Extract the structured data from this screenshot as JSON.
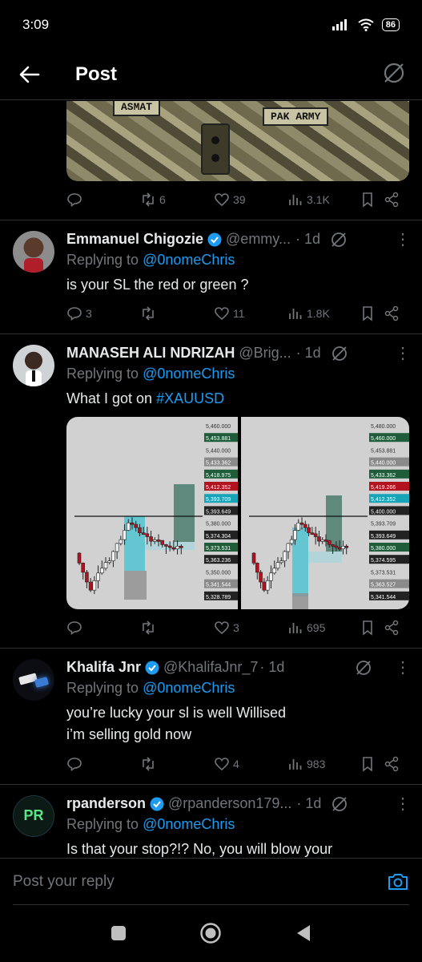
{
  "status": {
    "time": "3:09",
    "battery": "86"
  },
  "header": {
    "title": "Post"
  },
  "top_post": {
    "patch_left": "ASMAT",
    "patch_right": "PAK ARMY",
    "reposts": "6",
    "likes": "39",
    "views": "3.1K"
  },
  "tweets": [
    {
      "name": "Emmanuel Chigozie",
      "handle": "@emmy...",
      "time": "· 1d",
      "replying_prefix": "Replying to ",
      "replying_to": "@0nomeChris",
      "text": "is your SL the red or green ?",
      "replies": "3",
      "reposts": "",
      "likes": "11",
      "views": "1.8K"
    },
    {
      "name": "MANASEH ALI NDRIZAH",
      "handle": "@Brig...",
      "time": "· 1d",
      "replying_prefix": "Replying to ",
      "replying_to": "@0nomeChris",
      "text_prefix": "What I got on ",
      "hashtag": "#XAUUSD",
      "replies": "",
      "reposts": "",
      "likes": "3",
      "views": "695",
      "chart_left_prices": [
        "5,460.000",
        "5,453.881",
        "5,440.000",
        "5,433.362",
        "5,418.975",
        "5,412.352",
        "5,393.709",
        "5,393.649",
        "5,380.000",
        "5,374.304",
        "5,373.531",
        "5,363.236",
        "5,350.000",
        "5,341.544",
        "5,328.789"
      ],
      "chart_right_prices": [
        "5,480.000",
        "5,460.000",
        "5,453.881",
        "5,440.000",
        "5,433.362",
        "5,419.266",
        "5,412.352",
        "5,400.000",
        "5,393.709",
        "5,393.649",
        "5,380.000",
        "5,374.595",
        "5,373.531",
        "5,363.527",
        "5,341.544"
      ]
    },
    {
      "name": "Khalifa Jnr",
      "handle": "@KhalifaJnr_7",
      "time": "· 1d",
      "replying_prefix": "Replying to ",
      "replying_to": "@0nomeChris",
      "text_line1": "you’re lucky your sl is well Willised",
      "text_line2": "i’m selling gold now",
      "replies": "",
      "reposts": "",
      "likes": "4",
      "views": "983"
    },
    {
      "name": "rpanderson",
      "handle": "@rpanderson179...",
      "time": "· 1d",
      "replying_prefix": "Replying to ",
      "replying_to": "@0nomeChris",
      "text": "Is that your stop?!? No, you will blow your",
      "avatar_text": "PR"
    }
  ],
  "reply_bar": {
    "placeholder": "Post your reply"
  },
  "colors": {
    "accent": "#1d9bf0",
    "muted": "#71767b",
    "background": "#000000"
  }
}
